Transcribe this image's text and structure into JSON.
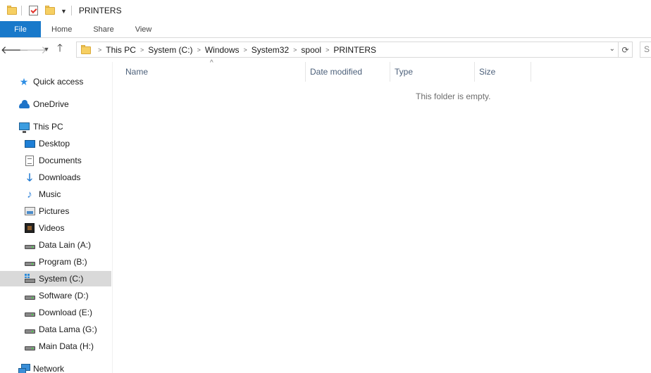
{
  "window": {
    "title": "PRINTERS"
  },
  "ribbon": {
    "tabs": [
      {
        "id": "file",
        "label": "File"
      },
      {
        "id": "home",
        "label": "Home"
      },
      {
        "id": "share",
        "label": "Share"
      },
      {
        "id": "view",
        "label": "View"
      }
    ]
  },
  "address": {
    "path": [
      "This PC",
      "System (C:)",
      "Windows",
      "System32",
      "spool",
      "PRINTERS"
    ],
    "search_placeholder": "S"
  },
  "nav": {
    "items": [
      {
        "id": "quick-access",
        "label": "Quick access",
        "icon": "quick-access-icon",
        "indent": 0
      },
      {
        "id": "onedrive",
        "label": "OneDrive",
        "icon": "onedrive-icon",
        "indent": 0
      },
      {
        "id": "this-pc",
        "label": "This PC",
        "icon": "this-pc-icon",
        "indent": 0
      },
      {
        "id": "desktop",
        "label": "Desktop",
        "icon": "desktop-icon",
        "indent": 1
      },
      {
        "id": "documents",
        "label": "Documents",
        "icon": "documents-icon",
        "indent": 1
      },
      {
        "id": "downloads",
        "label": "Downloads",
        "icon": "downloads-icon",
        "indent": 1
      },
      {
        "id": "music",
        "label": "Music",
        "icon": "music-icon",
        "indent": 1
      },
      {
        "id": "pictures",
        "label": "Pictures",
        "icon": "pictures-icon",
        "indent": 1
      },
      {
        "id": "videos",
        "label": "Videos",
        "icon": "videos-icon",
        "indent": 1
      },
      {
        "id": "data-lain",
        "label": "Data Lain (A:)",
        "icon": "drive-icon",
        "indent": 1
      },
      {
        "id": "program",
        "label": "Program (B:)",
        "icon": "drive-icon",
        "indent": 1
      },
      {
        "id": "system",
        "label": "System (C:)",
        "icon": "system-drive-icon",
        "indent": 1,
        "selected": true
      },
      {
        "id": "software",
        "label": "Software (D:)",
        "icon": "drive-icon",
        "indent": 1
      },
      {
        "id": "download",
        "label": "Download (E:)",
        "icon": "drive-icon",
        "indent": 1
      },
      {
        "id": "data-lama",
        "label": "Data Lama (G:)",
        "icon": "drive-icon",
        "indent": 1
      },
      {
        "id": "main-data",
        "label": "Main Data (H:)",
        "icon": "drive-icon",
        "indent": 1
      },
      {
        "id": "network",
        "label": "Network",
        "icon": "network-icon",
        "indent": 0
      }
    ]
  },
  "columns": [
    {
      "id": "name",
      "label": "Name"
    },
    {
      "id": "date-modified",
      "label": "Date modified"
    },
    {
      "id": "type",
      "label": "Type"
    },
    {
      "id": "size",
      "label": "Size"
    }
  ],
  "content": {
    "empty_message": "This folder is empty."
  },
  "colors": {
    "file_tab": "#1979ca",
    "selected_item": "#d9d9d9",
    "column_header_text": "#4c607a"
  }
}
